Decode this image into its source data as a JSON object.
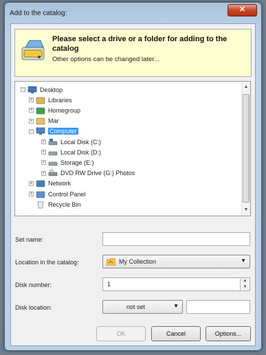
{
  "window": {
    "title": "Add to the catalog:",
    "close_label": "✕"
  },
  "header": {
    "title": "Please select a drive or a folder for adding to the catalog",
    "subtitle": "Other options can be changed later..."
  },
  "tree": {
    "items": [
      {
        "label": "Desktop",
        "icon": "desktop-icon",
        "expander": "−"
      },
      {
        "label": "Libraries",
        "icon": "libraries-icon",
        "expander": "+"
      },
      {
        "label": "Homegroup",
        "icon": "homegroup-icon",
        "expander": "+"
      },
      {
        "label": "Mar",
        "icon": "user-folder-icon",
        "expander": "+"
      },
      {
        "label": "Computer",
        "icon": "computer-icon",
        "expander": "−",
        "selected": true
      },
      {
        "label": "Local Disk (C:)",
        "icon": "system-disk-icon",
        "expander": "+"
      },
      {
        "label": "Local Disk (D:)",
        "icon": "hard-disk-icon",
        "expander": "+"
      },
      {
        "label": "Storage (E:)",
        "icon": "hard-disk-icon",
        "expander": "+"
      },
      {
        "label": "DVD RW Drive (G:) Photos",
        "icon": "dvd-drive-icon",
        "expander": "+"
      },
      {
        "label": "Network",
        "icon": "network-icon",
        "expander": "+"
      },
      {
        "label": "Control Panel",
        "icon": "control-panel-icon",
        "expander": "+"
      },
      {
        "label": "Recycle Bin",
        "icon": "recycle-bin-icon",
        "expander": ""
      }
    ]
  },
  "form": {
    "set_name_label": "Set name:",
    "set_name_value": "",
    "location_label": "Location in the catalog:",
    "location_value": "My Collection",
    "disk_number_label": "Disk number:",
    "disk_number_value": "1",
    "disk_location_label": "Disk location:",
    "disk_location_value": "not set",
    "disk_location_text": ""
  },
  "buttons": {
    "ok": "OK",
    "cancel": "Cancel",
    "options": "Options..."
  },
  "colors": {
    "selection": "#3399ff",
    "header_bg": "#fefed0",
    "close": "#c7452b"
  }
}
